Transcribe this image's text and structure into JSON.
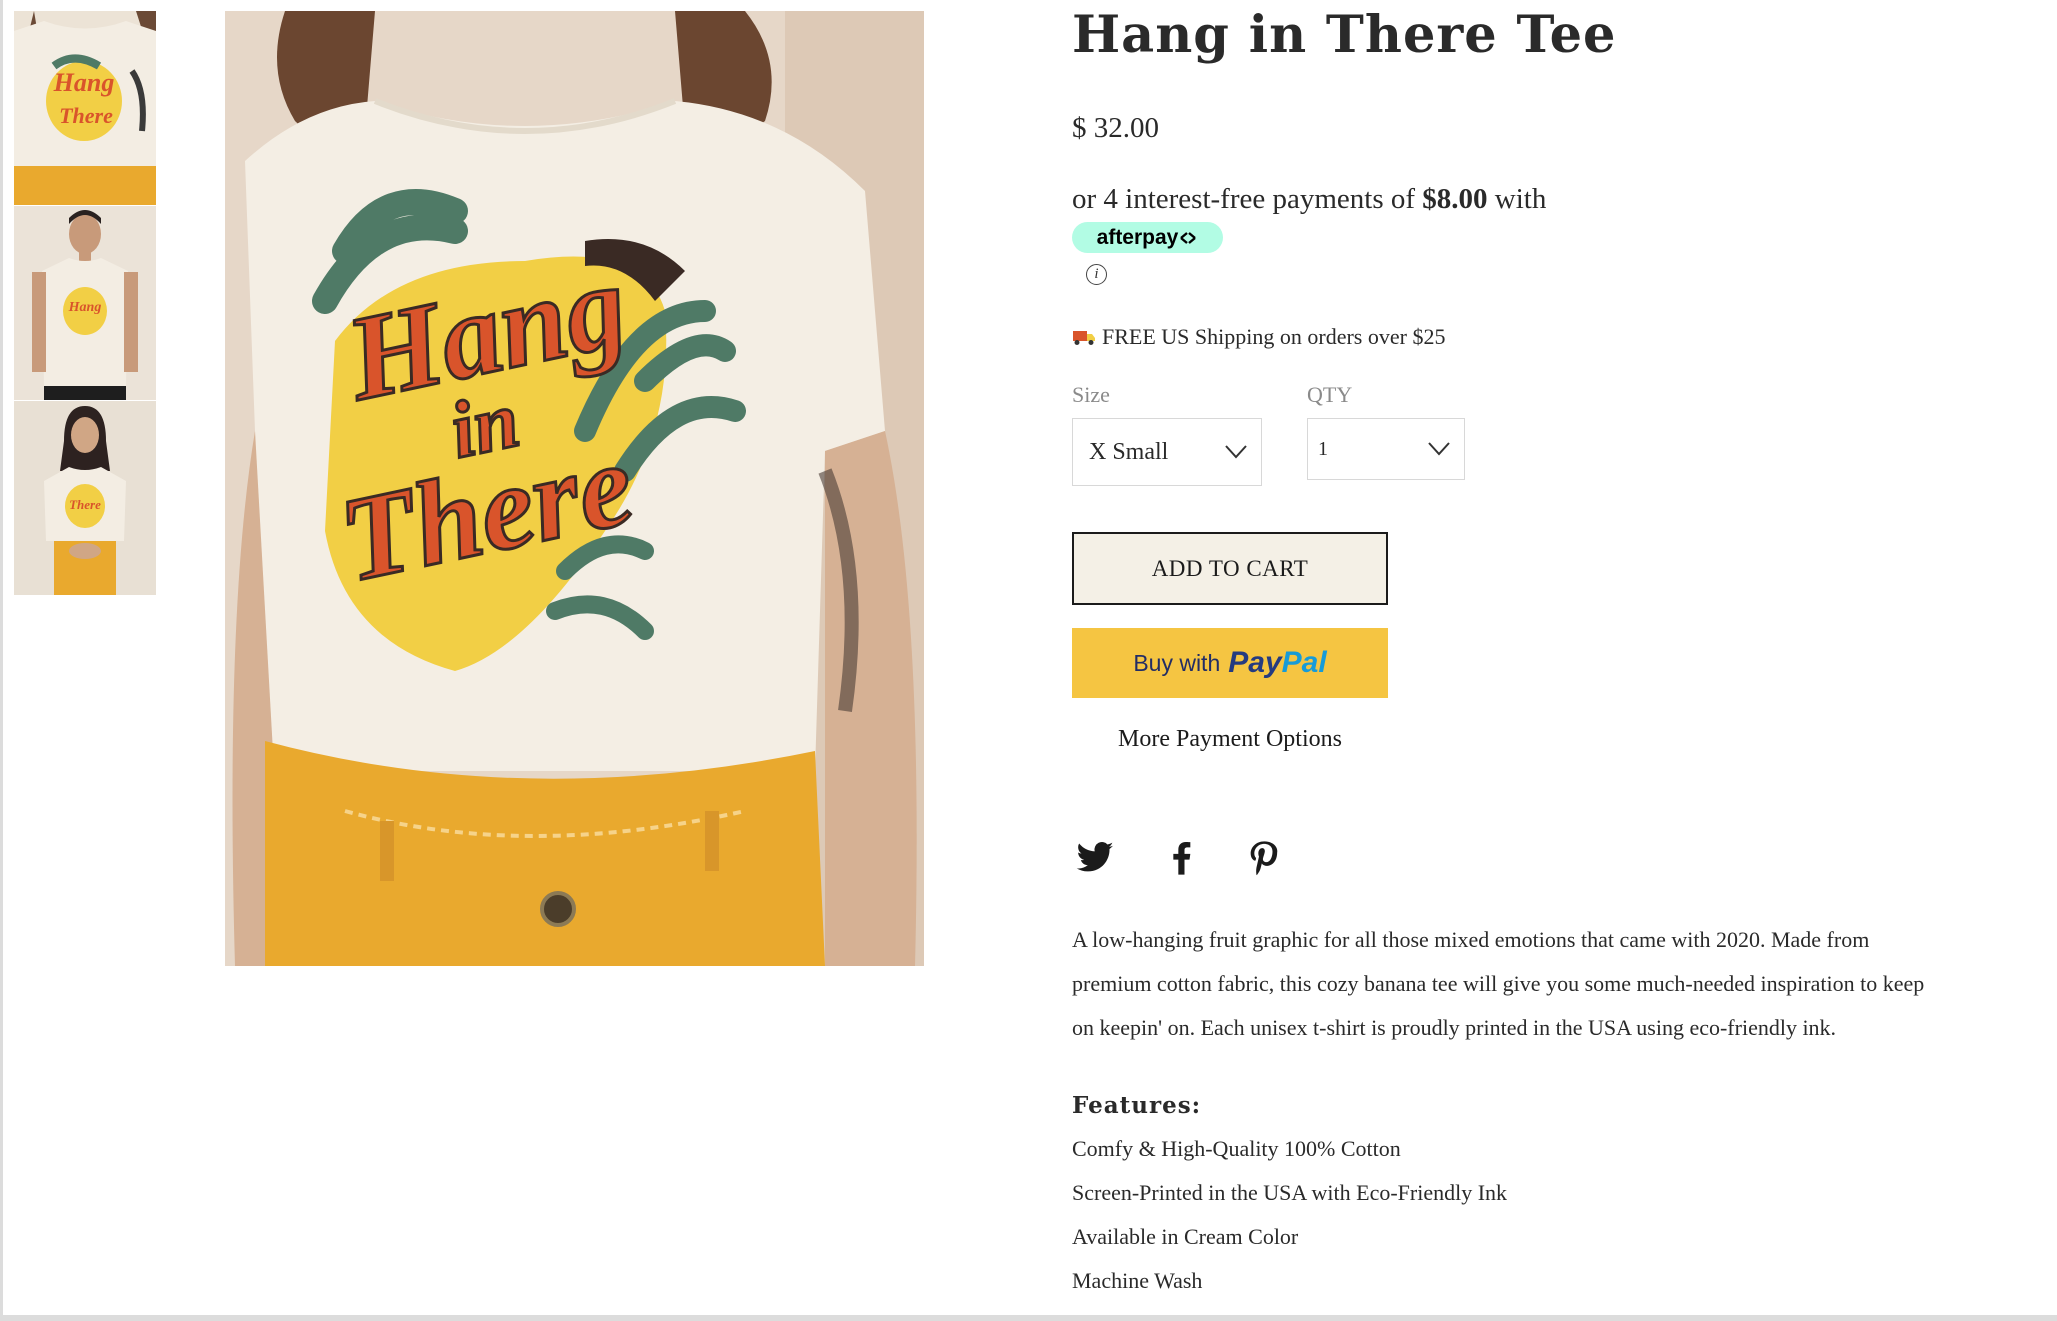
{
  "product": {
    "title": "Hang in There Tee",
    "price": "$ 32.00"
  },
  "afterpay": {
    "text_before": "or 4 interest-free payments of ",
    "amount": "$8.00",
    "text_after": " with",
    "badge": "afterpay",
    "info_glyph": "ⓘ"
  },
  "shipping": {
    "icon": "truck-icon",
    "text": "FREE US Shipping on orders over $25"
  },
  "options": {
    "size_label": "Size",
    "size_value": "X Small",
    "qty_label": "QTY",
    "qty_value": "1"
  },
  "buttons": {
    "add_to_cart": "ADD TO CART",
    "paypal_buy": "Buy with",
    "paypal_brand_1": "Pay",
    "paypal_brand_2": "Pal",
    "more_options": "More Payment Options"
  },
  "social": [
    "twitter-icon",
    "facebook-icon",
    "pinterest-icon"
  ],
  "description": "A low-hanging fruit graphic for all those mixed emotions that came with 2020. Made from premium cotton fabric, this cozy banana tee will give you some much-needed inspiration to keep on keepin' on. Each unisex t-shirt is proudly printed in the USA using eco-friendly ink.",
  "features": {
    "title": "Features:",
    "items": [
      "Comfy & High-Quality 100% Cotton",
      "Screen-Printed in the USA with Eco-Friendly Ink",
      "Available in Cream Color",
      "Machine Wash"
    ]
  },
  "graphic_text": [
    "Hang",
    "in",
    "There"
  ],
  "colors": {
    "cream": "#f2ece1",
    "mustard": "#e9a92e",
    "banana": "#f2cf45",
    "tomato": "#d9542b",
    "palm": "#4f7a66",
    "afterpay": "#b2fce4",
    "paypal_yellow": "#f5c542"
  }
}
